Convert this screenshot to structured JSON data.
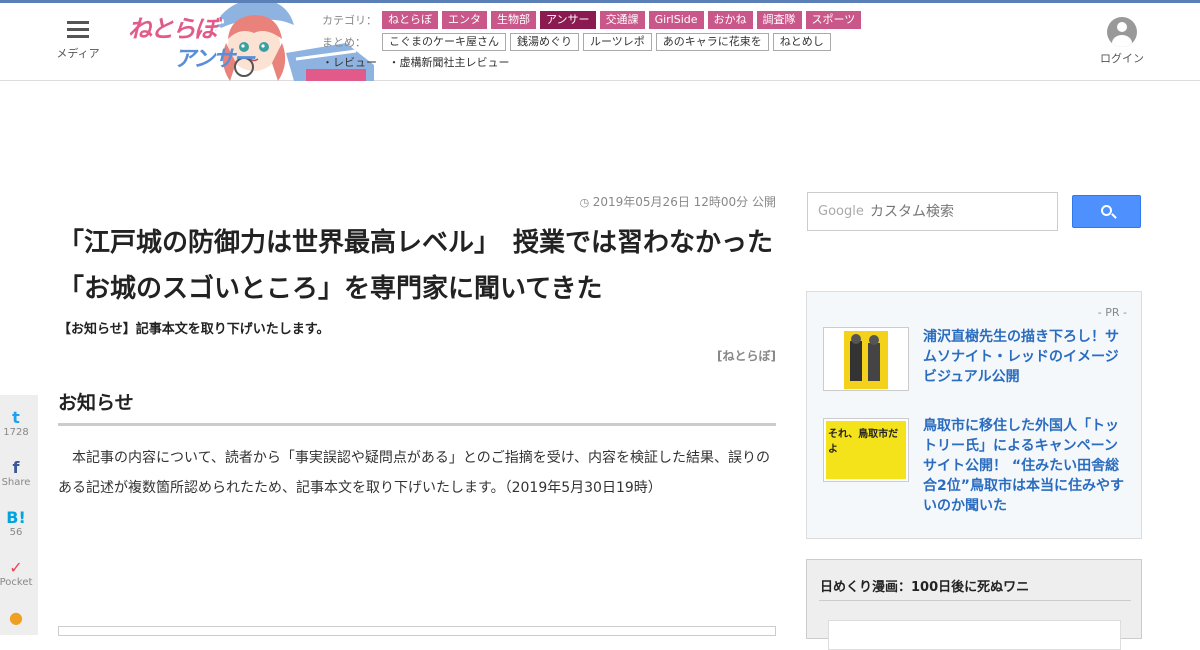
{
  "header": {
    "menu_label": "メディア",
    "logo_text_1": "ねとらぼ",
    "logo_text_2": "アンサー",
    "login_label": "ログイン",
    "category_label": "カテゴリ：",
    "categories": [
      {
        "label": "ねとらぼ",
        "active": false
      },
      {
        "label": "エンタ",
        "active": false
      },
      {
        "label": "生物部",
        "active": false
      },
      {
        "label": "アンサー",
        "active": true
      },
      {
        "label": "交通課",
        "active": false
      },
      {
        "label": "GirlSide",
        "active": false
      },
      {
        "label": "おかね",
        "active": false
      },
      {
        "label": "調査隊",
        "active": false
      },
      {
        "label": "スポーツ",
        "active": false
      }
    ],
    "matome_label": "まとめ：",
    "matome": [
      "こぐまのケーキ屋さん",
      "銭湯めぐり",
      "ルーツレポ",
      "あのキャラに花束を",
      "ねとめし"
    ],
    "reviews": [
      "・レビュー",
      "・虚構新聞社主レビュー"
    ]
  },
  "article": {
    "date": "2019年05月26日 12時00分 公開",
    "title": "「江戸城の防御力は世界最高レベル」　授業では習わなかった「お城のスゴいところ」を専門家に聞いてきた",
    "lead": "【お知らせ】記事本文を取り下げいたします。",
    "credit": "[ねとらぼ]",
    "section_heading": "お知らせ",
    "body": "本記事の内容について、読者から「事実誤認や疑問点がある」とのご指摘を受け、内容を検証した結果、誤りのある記述が複数箇所認められたため、記事本文を取り下げいたします。（2019年5月30日19時）"
  },
  "share": [
    {
      "icon": "twitter-icon",
      "glyph": "t",
      "label": "1728",
      "color": "#1da1f2"
    },
    {
      "icon": "facebook-icon",
      "glyph": "f",
      "label": "Share",
      "color": "#3b5998"
    },
    {
      "icon": "hatena-icon",
      "glyph": "B!",
      "label": "56",
      "color": "#00a4de"
    },
    {
      "icon": "pocket-icon",
      "glyph": "✓",
      "label": "Pocket",
      "color": "#ef4056"
    },
    {
      "icon": "comment-icon",
      "glyph": "●",
      "label": "",
      "color": "#f0a020"
    }
  ],
  "sidebar": {
    "search": {
      "brand": "Google",
      "placeholder": "カスタム検索"
    },
    "pr": {
      "tag": "- PR -",
      "items": [
        {
          "text": "浦沢直樹先生の描き下ろし！サムソナイト・レッドのイメージビジュアル公開"
        },
        {
          "text": "鳥取市に移住した外国人「トットリー氏」によるキャンペーンサイト公開！ “住みたい田舎総合2位”鳥取市は本当に住みやすいのか聞いた",
          "thumb_text": "それ、鳥取市だよ"
        }
      ]
    },
    "manga": {
      "heading": "日めくり漫画：100日後に死ぬワニ"
    }
  },
  "colors": {
    "accent_bar": "#5b7fb7",
    "category": "#c9578a",
    "category_active": "#8b1a50",
    "link": "#2a6cbf"
  }
}
